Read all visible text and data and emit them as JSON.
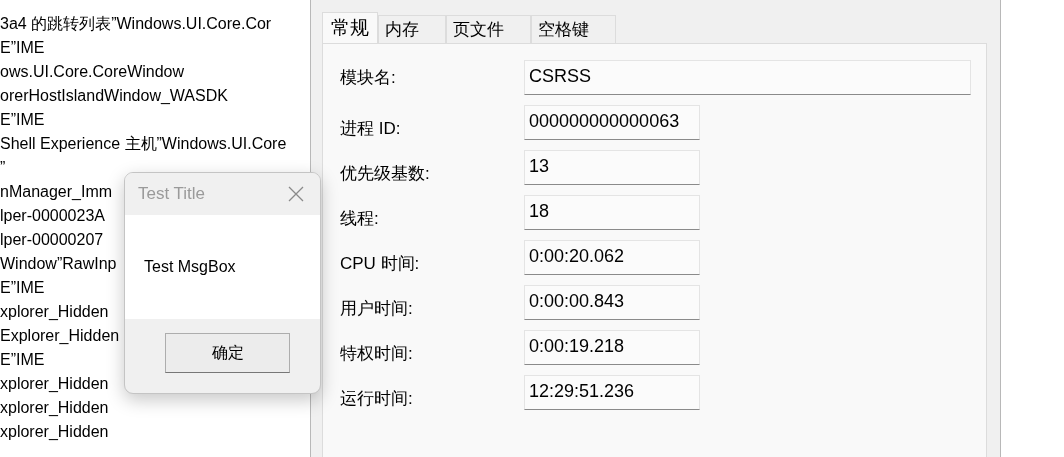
{
  "background_list": {
    "lines": [
      "3a4 的跳转列表”Windows.UI.Core.Cor",
      "E”IME",
      "ows.UI.Core.CoreWindow",
      "orerHostIslandWindow_WASDK",
      "E”IME",
      "Shell Experience 主机”Windows.UI.Core",
      "”",
      "nManager_Imm",
      "lper-0000023A",
      "lper-00000207",
      "Window”RawInp",
      "E”IME",
      "xplorer_Hidden",
      "Explorer_Hidden",
      "E”IME",
      "xplorer_Hidden",
      "xplorer_Hidden",
      "xplorer_Hidden"
    ]
  },
  "properties_dialog": {
    "tabs": [
      {
        "label": "常规",
        "selected": true
      },
      {
        "label": "内存",
        "selected": false
      },
      {
        "label": "页文件",
        "selected": false
      },
      {
        "label": "空格键",
        "selected": false
      }
    ],
    "fields": [
      {
        "label": "模块名:",
        "value": "CSRSS",
        "kind": "wide"
      },
      {
        "label": "进程 ID:",
        "value": "000000000000063",
        "kind": "normal"
      },
      {
        "label": "优先级基数:",
        "value": "13",
        "kind": "normal"
      },
      {
        "label": "线程:",
        "value": "18",
        "kind": "normal"
      },
      {
        "label": "CPU 时间:",
        "value": "0:00:20.062",
        "kind": "normal"
      },
      {
        "label": "用户时间:",
        "value": "0:00:00.843",
        "kind": "normal"
      },
      {
        "label": "特权时间:",
        "value": "0:00:19.218",
        "kind": "normal"
      },
      {
        "label": "运行时间:",
        "value": "12:29:51.236",
        "kind": "normal"
      }
    ]
  },
  "message_box": {
    "title": "Test Title",
    "message": "Test MsgBox",
    "buttons": [
      "确定"
    ]
  }
}
